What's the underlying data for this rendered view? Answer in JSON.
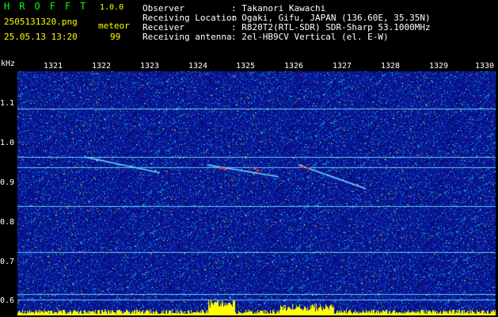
{
  "app": {
    "title_letters": [
      "H",
      "R",
      "O",
      "F",
      "F",
      "T"
    ],
    "version": "1.0.0",
    "filename": "2505131320.png",
    "datetime": "25.05.13 13:20",
    "mode_label": "meteor",
    "count": "99"
  },
  "info": {
    "rows": [
      {
        "label": "Observer",
        "value": ": Takanori Kawachi"
      },
      {
        "label": "Receiving Location",
        "value": ": Ogaki, Gifu, JAPAN (136.60E, 35.35N)"
      },
      {
        "label": "Receiver",
        "value": ": R820T2(RTL-SDR) SDR-Sharp 53.1000MHz"
      },
      {
        "label": "Receiving antenna",
        "value": ": 2el-HB9CV Vertical (el. E-W)"
      }
    ]
  },
  "axes": {
    "y_unit": "kHz",
    "x_ticks": [
      "1321",
      "1322",
      "1323",
      "1324",
      "1325",
      "1326",
      "1327",
      "1328",
      "1329",
      "1330"
    ],
    "y_ticks": [
      "1.1",
      "1.0",
      "0.9",
      "0.8",
      "0.7",
      "0.6"
    ]
  },
  "colors": {
    "title": "#00ff00",
    "version": "#ffff00",
    "info_text": "#ffffff",
    "background": "#000000",
    "noise_floor": "#0a1aa0",
    "level_bars": "#ffff00"
  }
}
